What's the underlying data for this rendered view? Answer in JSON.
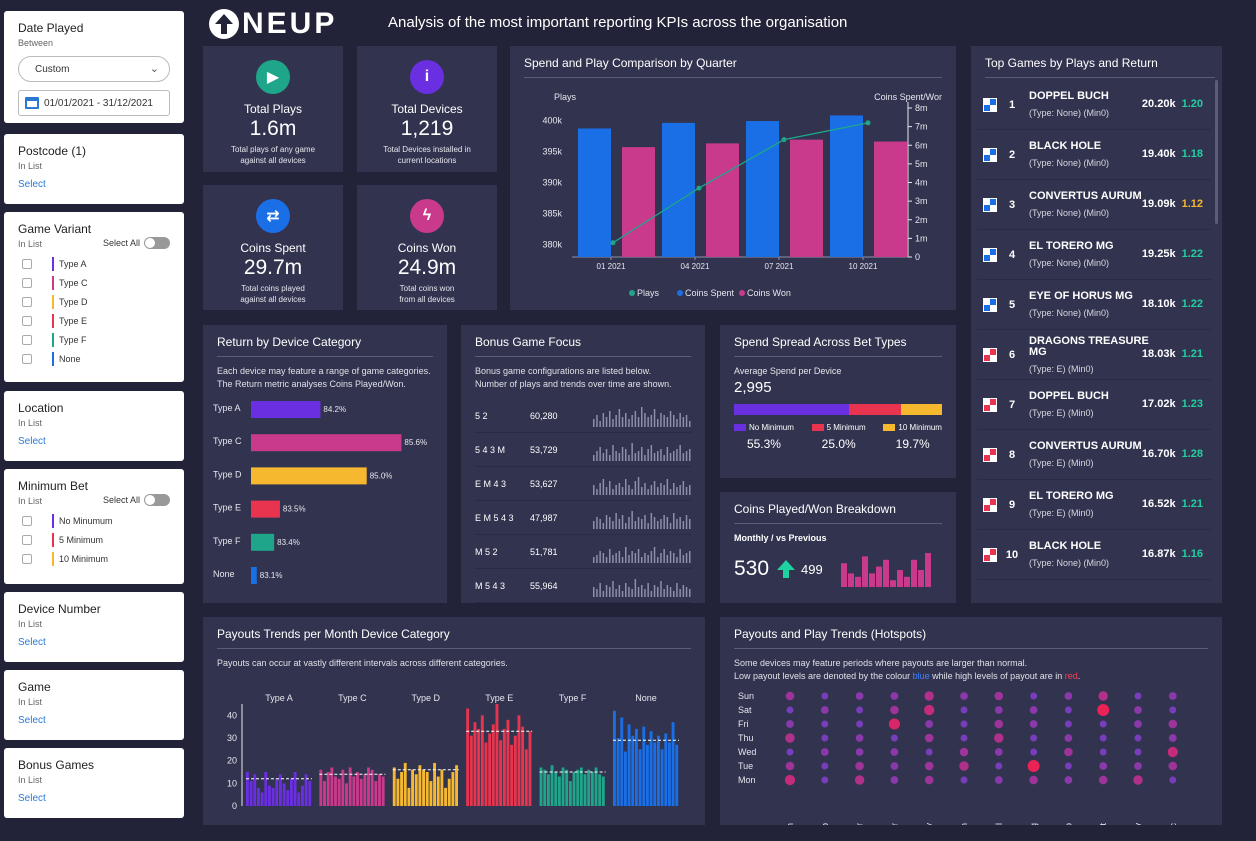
{
  "header": {
    "logo_text": "NEUP",
    "subtitle": "Analysis of the most important reporting KPIs across the organisation"
  },
  "filters": {
    "date_played": {
      "title": "Date Played",
      "sub": "Between",
      "dropdown_value": "Custom",
      "range": "01/01/2021 - 31/12/2021"
    },
    "postcode": {
      "title": "Postcode (1)",
      "sub": "In List",
      "action": "Select"
    },
    "game_variant": {
      "title": "Game Variant",
      "sub": "In List",
      "select_all": "Select All",
      "options": [
        {
          "label": "Type A",
          "color": "#6a2fe0"
        },
        {
          "label": "Type C",
          "color": "#c93a8c"
        },
        {
          "label": "Type D",
          "color": "#f5b82e"
        },
        {
          "label": "Type E",
          "color": "#e8344e"
        },
        {
          "label": "Type F",
          "color": "#1fa58a"
        },
        {
          "label": "None",
          "color": "#1a6fe6"
        }
      ]
    },
    "location": {
      "title": "Location",
      "sub": "In List",
      "action": "Select"
    },
    "minimum_bet": {
      "title": "Minimum Bet",
      "sub": "In List",
      "select_all": "Select All",
      "options": [
        {
          "label": "No Minumum",
          "color": "#6a2fe0"
        },
        {
          "label": "5 Minimum",
          "color": "#e8344e"
        },
        {
          "label": "10 Minimum",
          "color": "#f5b82e"
        }
      ]
    },
    "device_number": {
      "title": "Device Number",
      "sub": "In List",
      "action": "Select"
    },
    "game": {
      "title": "Game",
      "sub": "In List",
      "action": "Select"
    },
    "bonus_games": {
      "title": "Bonus Games",
      "sub": "In List",
      "action": "Select"
    }
  },
  "kpis": [
    {
      "label": "Total Plays",
      "value": "1.6m",
      "desc1": "Total plays of any game",
      "desc2": "against all devices",
      "color": "#1fa58a",
      "icon": "play-icon",
      "glyph": "▶"
    },
    {
      "label": "Total Devices",
      "value": "1,219",
      "desc1": "Total Devices installed in",
      "desc2": "current locations",
      "color": "#6a2fe0",
      "icon": "info-icon",
      "glyph": "i"
    },
    {
      "label": "Coins Spent",
      "value": "29.7m",
      "desc1": "Total coins played",
      "desc2": "against all devices",
      "color": "#1a6fe6",
      "icon": "swap-icon",
      "glyph": "⇄"
    },
    {
      "label": "Coins Won",
      "value": "24.9m",
      "desc1": "Total coins won",
      "desc2": "from all devices",
      "color": "#c93a8c",
      "icon": "bolt-icon",
      "glyph": "ϟ"
    }
  ],
  "spend_play": {
    "title": "Spend and Play Comparison by Quarter",
    "left_axis_title": "Plays",
    "right_axis_title": "Coins Spent/Won",
    "legend": [
      "Plays",
      "Coins Spent",
      "Coins Won"
    ],
    "colors": {
      "plays": "#1fa58a",
      "spent": "#1a6fe6",
      "won": "#c93a8c"
    }
  },
  "top_games": {
    "title": "Top Games by Plays and Return",
    "items": [
      {
        "rank": "1",
        "name": "DOPPEL BUCH",
        "sub": "(Type: None) (Min0)",
        "value": "20.20k",
        "ret": "1.20",
        "ret_color": "#1fd1a0",
        "icon_color": "#1a6fe6"
      },
      {
        "rank": "2",
        "name": "BLACK HOLE",
        "sub": "(Type: None) (Min0)",
        "value": "19.40k",
        "ret": "1.18",
        "ret_color": "#1fd1a0",
        "icon_color": "#1a6fe6"
      },
      {
        "rank": "3",
        "name": "CONVERTUS AURUM",
        "sub": "(Type: None) (Min0)",
        "value": "19.09k",
        "ret": "1.12",
        "ret_color": "#f5b82e",
        "icon_color": "#1a6fe6"
      },
      {
        "rank": "4",
        "name": "EL TORERO MG",
        "sub": "(Type: None) (Min0)",
        "value": "19.25k",
        "ret": "1.22",
        "ret_color": "#1fd1a0",
        "icon_color": "#1a6fe6"
      },
      {
        "rank": "5",
        "name": "EYE OF HORUS MG",
        "sub": "(Type: None) (Min0)",
        "value": "18.10k",
        "ret": "1.22",
        "ret_color": "#1fd1a0",
        "icon_color": "#1a6fe6"
      },
      {
        "rank": "6",
        "name": "DRAGONS TREASURE MG",
        "sub": "(Type: E) (Min0)",
        "value": "18.03k",
        "ret": "1.21",
        "ret_color": "#1fd1a0",
        "icon_color": "#e8344e"
      },
      {
        "rank": "7",
        "name": "DOPPEL BUCH",
        "sub": "(Type: E) (Min0)",
        "value": "17.02k",
        "ret": "1.23",
        "ret_color": "#1fd1a0",
        "icon_color": "#e8344e"
      },
      {
        "rank": "8",
        "name": "CONVERTUS AURUM",
        "sub": "(Type: E) (Min0)",
        "value": "16.70k",
        "ret": "1.28",
        "ret_color": "#1fd1a0",
        "icon_color": "#e8344e"
      },
      {
        "rank": "9",
        "name": "EL TORERO MG",
        "sub": "(Type: E) (Min0)",
        "value": "16.52k",
        "ret": "1.21",
        "ret_color": "#1fd1a0",
        "icon_color": "#e8344e"
      },
      {
        "rank": "10",
        "name": "BLACK HOLE",
        "sub": "(Type: None) (Min0)",
        "value": "16.87k",
        "ret": "1.16",
        "ret_color": "#1fd1a0",
        "icon_color": "#e8344e"
      }
    ]
  },
  "return_device": {
    "title": "Return by Device Category",
    "desc1": "Each device may feature a range of game categories.",
    "desc2": "The Return metric  analyses Coins Played/Won."
  },
  "bonus_focus": {
    "title": "Bonus Game Focus",
    "desc1": "Bonus game configurations are listed below.",
    "desc2": "Number of plays and trends over time are shown.",
    "rows": [
      {
        "name": "5 2",
        "value": "60,280"
      },
      {
        "name": "5 4 3 M",
        "value": "53,729"
      },
      {
        "name": "E M 4 3",
        "value": "53,627"
      },
      {
        "name": "E M 5 4 3",
        "value": "47,987"
      },
      {
        "name": "M 5 2",
        "value": "51,781"
      },
      {
        "name": "M 5 4 3",
        "value": "55,964"
      }
    ]
  },
  "spend_spread": {
    "title": "Spend Spread Across Bet Types",
    "avg_label": "Average Spend per Device",
    "avg_value": "2,995",
    "segments": [
      {
        "label": "No Minimum",
        "pct": "55.3%",
        "value": 55.3,
        "color": "#6a2fe0"
      },
      {
        "label": "5 Minimum",
        "pct": "25.0%",
        "value": 25.0,
        "color": "#e8344e"
      },
      {
        "label": "10 Minimum",
        "pct": "19.7%",
        "value": 19.7,
        "color": "#f5b82e"
      }
    ]
  },
  "coins_breakdown": {
    "title": "Coins Played/Won Breakdown",
    "sub": "Monthly / vs Previous",
    "current": "530",
    "previous": "499",
    "arrow_color": "#1fd1a0",
    "bar_color": "#c93a8c"
  },
  "payouts_trends": {
    "title": "Payouts Trends per Month Device Category",
    "desc": "Payouts can occur at vastly different intervals across different categories."
  },
  "hotspots": {
    "title": "Payouts and Play Trends (Hotspots)",
    "desc1": "Some devices may feature periods where payouts are larger than normal.",
    "desc2_a": "Low payout levels are denoted by the colour ",
    "desc2_blue": "blue",
    "desc2_b": " while high levels of payout are in ",
    "desc2_red": "red",
    "desc2_c": "."
  },
  "chart_data": [
    {
      "id": "spend_play",
      "type": "bar",
      "categories": [
        "01 2021",
        "04 2021",
        "07 2021",
        "10 2021"
      ],
      "series": [
        {
          "name": "Coins Spent",
          "axis": "right",
          "values": [
            6.9,
            7.2,
            7.3,
            7.6
          ]
        },
        {
          "name": "Coins Won",
          "axis": "right",
          "values": [
            5.9,
            6.1,
            6.3,
            6.2
          ]
        },
        {
          "name": "Plays",
          "axis": "left",
          "type": "line",
          "values": [
            380300,
            389100,
            396900,
            399600
          ]
        }
      ],
      "ylim_left": [
        378000,
        402000
      ],
      "yticks_left": [
        380000,
        385000,
        390000,
        395000,
        400000
      ],
      "ytick_labels_left": [
        "380k",
        "385k",
        "390k",
        "395k",
        "400k"
      ],
      "ylim_right": [
        0,
        8
      ],
      "yticks_right": [
        0,
        1,
        2,
        3,
        4,
        5,
        6,
        7,
        8
      ],
      "ytick_labels_right": [
        "0",
        "1m",
        "2m",
        "3m",
        "4m",
        "5m",
        "6m",
        "7m",
        "8m"
      ]
    },
    {
      "id": "return_device",
      "type": "bar",
      "orientation": "horizontal",
      "categories": [
        "Type A",
        "Type C",
        "Type D",
        "Type E",
        "Type F",
        "None"
      ],
      "values": [
        84.2,
        85.6,
        85.0,
        83.5,
        83.4,
        83.1
      ],
      "labels": [
        "84.2%",
        "85.6%",
        "85.0%",
        "83.5%",
        "83.4%",
        "83.1%"
      ],
      "colors": [
        "#6a2fe0",
        "#c93a8c",
        "#f5b82e",
        "#e8344e",
        "#1fa58a",
        "#1a6fe6"
      ],
      "xlim": [
        83.0,
        85.8
      ]
    },
    {
      "id": "bonus_sparklines",
      "type": "bar",
      "series": [
        {
          "name": "5 2",
          "values": [
            4,
            6,
            3,
            7,
            5,
            8,
            4,
            6,
            9,
            5,
            7,
            4,
            6,
            8,
            5,
            10,
            7,
            5,
            6,
            9,
            4,
            7,
            6,
            5,
            8,
            6,
            4,
            7,
            5,
            6,
            3
          ]
        },
        {
          "name": "5 4 3 M",
          "values": [
            3,
            5,
            7,
            4,
            6,
            3,
            8,
            5,
            4,
            7,
            6,
            3,
            9,
            4,
            5,
            7,
            3,
            6,
            8,
            4,
            5,
            6,
            3,
            7,
            4,
            5,
            6,
            8,
            4,
            5,
            6
          ]
        },
        {
          "name": "E M 4 3",
          "values": [
            5,
            3,
            6,
            8,
            4,
            7,
            3,
            5,
            6,
            4,
            8,
            5,
            3,
            7,
            9,
            4,
            6,
            3,
            5,
            7,
            4,
            6,
            5,
            8,
            3,
            6,
            4,
            5,
            7,
            4,
            5
          ]
        },
        {
          "name": "E M 5 4 3",
          "values": [
            4,
            6,
            5,
            3,
            7,
            6,
            4,
            8,
            5,
            7,
            3,
            6,
            9,
            4,
            6,
            5,
            7,
            3,
            8,
            6,
            4,
            5,
            7,
            6,
            3,
            8,
            5,
            6,
            4,
            7,
            5
          ]
        },
        {
          "name": "M 5 2",
          "values": [
            3,
            4,
            6,
            5,
            3,
            7,
            4,
            5,
            6,
            3,
            8,
            4,
            6,
            5,
            7,
            3,
            5,
            4,
            6,
            8,
            3,
            5,
            7,
            4,
            6,
            5,
            3,
            7,
            4,
            5,
            6
          ]
        },
        {
          "name": "M 5 4 3",
          "values": [
            5,
            4,
            7,
            3,
            6,
            5,
            8,
            4,
            6,
            3,
            7,
            5,
            4,
            9,
            5,
            6,
            4,
            7,
            3,
            6,
            5,
            8,
            4,
            6,
            5,
            3,
            7,
            4,
            6,
            5,
            4
          ]
        }
      ]
    },
    {
      "id": "coins_breakdown_bars",
      "type": "bar",
      "values": [
        7,
        4,
        3,
        9,
        4,
        6,
        8,
        2,
        5,
        3,
        8,
        5,
        10
      ]
    },
    {
      "id": "payouts_trends",
      "type": "bar",
      "ylim": [
        0,
        45
      ],
      "yticks": [
        0,
        10,
        20,
        30,
        40
      ],
      "groups": [
        {
          "name": "Type A",
          "color": "#6a2fe0",
          "avg": 12,
          "values": [
            15,
            11,
            14,
            8,
            6,
            15,
            9,
            8,
            12,
            14,
            10,
            7,
            12,
            15,
            6,
            9,
            14,
            11
          ]
        },
        {
          "name": "Type C",
          "color": "#c93a8c",
          "avg": 14,
          "values": [
            16,
            11,
            15,
            17,
            13,
            12,
            16,
            10,
            17,
            13,
            15,
            12,
            14,
            17,
            16,
            11,
            14,
            13
          ]
        },
        {
          "name": "Type D",
          "color": "#f5b82e",
          "avg": 16,
          "values": [
            17,
            12,
            15,
            19,
            8,
            16,
            14,
            18,
            16,
            15,
            11,
            19,
            13,
            16,
            8,
            12,
            15,
            18
          ]
        },
        {
          "name": "Type E",
          "color": "#e8344e",
          "avg": 33,
          "values": [
            43,
            31,
            37,
            34,
            40,
            28,
            32,
            36,
            45,
            29,
            34,
            38,
            27,
            31,
            40,
            35,
            25,
            33
          ]
        },
        {
          "name": "Type F",
          "color": "#1fa58a",
          "avg": 15,
          "values": [
            17,
            16,
            14,
            18,
            15,
            13,
            17,
            16,
            11,
            15,
            16,
            17,
            14,
            16,
            15,
            17,
            14,
            13
          ]
        },
        {
          "name": "None",
          "color": "#1a6fe6",
          "avg": 29,
          "values": [
            42,
            30,
            39,
            24,
            36,
            31,
            34,
            25,
            35,
            27,
            33,
            28,
            31,
            25,
            32,
            28,
            37,
            27
          ]
        }
      ]
    },
    {
      "id": "hotspots",
      "type": "scatter",
      "x": [
        "Jan",
        "Feb",
        "Mar",
        "Apr",
        "May",
        "Jun",
        "Jul",
        "Aug",
        "Sep",
        "Oct",
        "Nov",
        "Dec"
      ],
      "y": [
        "Sun",
        "Sat",
        "Fri",
        "Thu",
        "Wed",
        "Tue",
        "Mon"
      ],
      "values": [
        [
          5,
          3,
          4,
          4,
          6,
          4,
          5,
          3,
          4,
          6,
          3,
          4
        ],
        [
          3,
          4,
          3,
          5,
          7,
          3,
          4,
          4,
          3,
          9,
          4,
          3
        ],
        [
          4,
          3,
          3,
          8,
          4,
          3,
          5,
          4,
          3,
          3,
          4,
          5
        ],
        [
          6,
          3,
          4,
          3,
          5,
          3,
          6,
          3,
          4,
          3,
          3,
          4
        ],
        [
          3,
          4,
          4,
          4,
          3,
          5,
          4,
          3,
          5,
          3,
          3,
          7
        ],
        [
          5,
          3,
          5,
          4,
          5,
          6,
          3,
          9,
          3,
          4,
          4,
          5
        ],
        [
          7,
          3,
          6,
          4,
          5,
          3,
          4,
          5,
          4,
          5,
          6,
          3
        ]
      ],
      "scale": "1=low payout (blue) to 10=high payout (red)"
    }
  ]
}
